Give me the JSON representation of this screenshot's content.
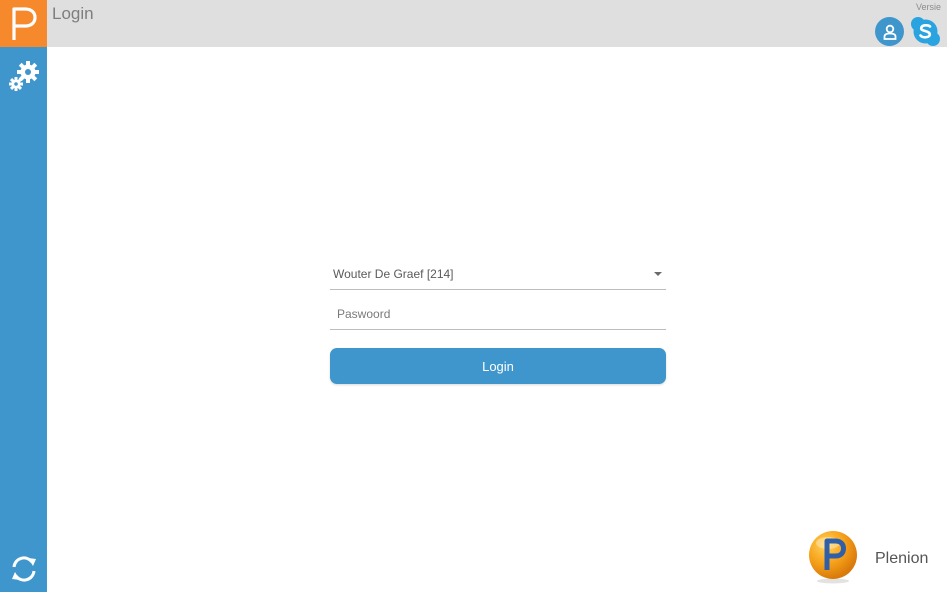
{
  "app": {
    "logo_letter": "P"
  },
  "header": {
    "title": "Login",
    "version_label": "Versie"
  },
  "sidebar": {
    "settings_icon": "gear-icon",
    "sync_icon": "sync-icon"
  },
  "login_form": {
    "user_select_value": "Wouter De Graef [214]",
    "password_placeholder": "Paswoord",
    "login_button_label": "Login"
  },
  "brand": {
    "logo_letter": "P",
    "name": "Plenion"
  },
  "colors": {
    "accent": "#3f96cc",
    "logo_tile": "#f5892b",
    "header_bg": "#dfdfdf",
    "brand_orange": "#f7a21b"
  }
}
